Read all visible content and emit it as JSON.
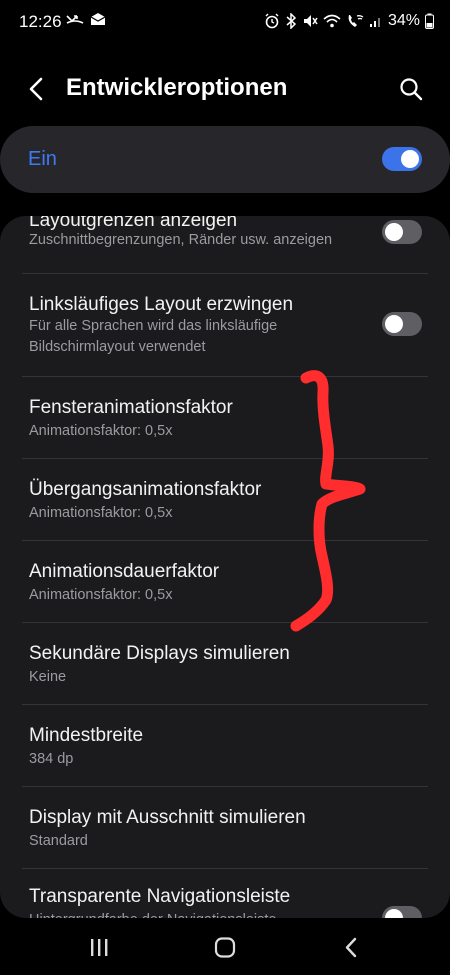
{
  "status_bar": {
    "time": "12:26",
    "battery": "34%",
    "icons": [
      "missed-call-icon",
      "mail-icon",
      "alarm-icon",
      "bluetooth-icon",
      "mute-icon",
      "wifi-icon",
      "wifi-calling-icon",
      "signal-icon",
      "battery-icon"
    ]
  },
  "header": {
    "title": "Entwickleroptionen",
    "back_icon": "back-arrow-icon",
    "search_icon": "search-icon"
  },
  "master_switch": {
    "label": "Ein",
    "on": true
  },
  "settings": [
    {
      "title": "Layoutgrenzen anzeigen",
      "subtitle": "Zuschnittbegrenzungen, Ränder usw. anzeigen",
      "toggle": "off"
    },
    {
      "title": "Linksläufiges Layout erzwingen",
      "subtitle": "Für alle Sprachen wird das linksläufige Bildschirmlayout verwendet",
      "toggle": "off"
    },
    {
      "title": "Fensteranimationsfaktor",
      "subtitle": "Animationsfaktor: 0,5x"
    },
    {
      "title": "Übergangsanimationsfaktor",
      "subtitle": "Animationsfaktor: 0,5x"
    },
    {
      "title": "Animationsdauerfaktor",
      "subtitle": "Animationsfaktor: 0,5x"
    },
    {
      "title": "Sekundäre Displays simulieren",
      "subtitle": "Keine"
    },
    {
      "title": "Mindestbreite",
      "subtitle": "384 dp"
    },
    {
      "title": "Display mit Ausschnitt simulieren",
      "subtitle": "Standard"
    },
    {
      "title": "Transparente Navigationsleiste",
      "subtitle": "Hintergrundfarbe der Navigationsleiste",
      "toggle": "off"
    }
  ],
  "nav_bar": {
    "recents_icon": "recents-icon",
    "home_icon": "home-icon",
    "back_icon": "back-icon"
  },
  "colors": {
    "accent": "#3d73e8",
    "annotation": "#ff2d2d",
    "background": "#000000",
    "card": "#1b1b1e"
  }
}
